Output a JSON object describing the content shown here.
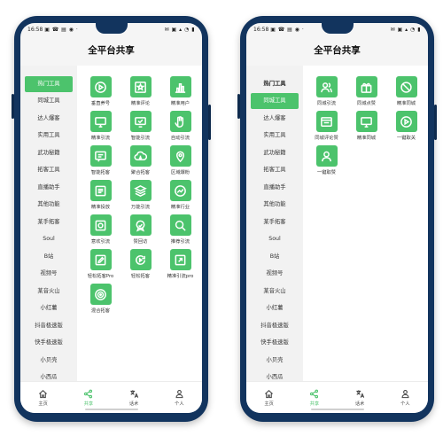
{
  "colors": {
    "accent": "#4cc36c",
    "phone_frame": "#12345e"
  },
  "phones": [
    {
      "status": {
        "time": "16:58",
        "left_icons": "▣ ☎ ▤ ◉ ·",
        "right_icons": "✉ ▣ ▴ ◔ ▮"
      },
      "title": "全平台共享",
      "sidebar": [
        {
          "label": "热门工具",
          "state": "active"
        },
        {
          "label": "同城工具",
          "state": ""
        },
        {
          "label": "达人爆客",
          "state": ""
        },
        {
          "label": "实用工具",
          "state": ""
        },
        {
          "label": "武功秘籍",
          "state": ""
        },
        {
          "label": "拓客工具",
          "state": ""
        },
        {
          "label": "直播助手",
          "state": ""
        },
        {
          "label": "其他功能",
          "state": ""
        },
        {
          "label": "某手拓客",
          "state": ""
        },
        {
          "label": "Soul",
          "state": ""
        },
        {
          "label": "B站",
          "state": ""
        },
        {
          "label": "视频号",
          "state": ""
        },
        {
          "label": "某音火山",
          "state": ""
        },
        {
          "label": "小红薯",
          "state": ""
        },
        {
          "label": "抖音极速版",
          "state": ""
        },
        {
          "label": "快手极速版",
          "state": ""
        },
        {
          "label": "小贝壳",
          "state": ""
        },
        {
          "label": "小西瓜",
          "state": ""
        }
      ],
      "tools": [
        {
          "label": "垂直养号",
          "icon": "play-icon"
        },
        {
          "label": "精准评论",
          "icon": "star-icon"
        },
        {
          "label": "精准用户",
          "icon": "bar-chart-icon"
        },
        {
          "label": "精准引流",
          "icon": "screen-icon"
        },
        {
          "label": "智能引流",
          "icon": "screen-check-icon"
        },
        {
          "label": "自动引流",
          "icon": "hand-icon"
        },
        {
          "label": "智能拓客",
          "icon": "message-icon"
        },
        {
          "label": "聚合拓客",
          "icon": "cloud-icon"
        },
        {
          "label": "区域爆粉",
          "icon": "map-pin-icon"
        },
        {
          "label": "精准投放",
          "icon": "frame-icon"
        },
        {
          "label": "万能引流",
          "icon": "layers-icon"
        },
        {
          "label": "精准行业",
          "icon": "trend-icon"
        },
        {
          "label": "意欢引流",
          "icon": "dial-icon"
        },
        {
          "label": "赞回访",
          "icon": "badge-icon"
        },
        {
          "label": "推荐引流",
          "icon": "search-icon"
        },
        {
          "label": "轻松拓客Pro",
          "icon": "pencil-icon"
        },
        {
          "label": "轻松拓客",
          "icon": "refresh-icon"
        },
        {
          "label": "精准引流pro",
          "icon": "share-box-icon"
        },
        {
          "label": "混合拓客",
          "icon": "target-icon"
        }
      ]
    },
    {
      "status": {
        "time": "16:58",
        "left_icons": "▣ ☎ ▤ ◉ ·",
        "right_icons": "✉ ▣ ▴ ◔ ▮"
      },
      "title": "全平台共享",
      "sidebar": [
        {
          "label": "热门工具",
          "state": "heading"
        },
        {
          "label": "同城工具",
          "state": "active"
        },
        {
          "label": "达人爆客",
          "state": ""
        },
        {
          "label": "实用工具",
          "state": ""
        },
        {
          "label": "武功秘籍",
          "state": ""
        },
        {
          "label": "拓客工具",
          "state": ""
        },
        {
          "label": "直播助手",
          "state": ""
        },
        {
          "label": "其他功能",
          "state": ""
        },
        {
          "label": "某手拓客",
          "state": ""
        },
        {
          "label": "Soul",
          "state": ""
        },
        {
          "label": "B站",
          "state": ""
        },
        {
          "label": "视频号",
          "state": ""
        },
        {
          "label": "某音火山",
          "state": ""
        },
        {
          "label": "小红薯",
          "state": ""
        },
        {
          "label": "抖音极速版",
          "state": ""
        },
        {
          "label": "快手极速版",
          "state": ""
        },
        {
          "label": "小贝壳",
          "state": ""
        },
        {
          "label": "小西瓜",
          "state": ""
        }
      ],
      "tools": [
        {
          "label": "同城引流",
          "icon": "users-icon"
        },
        {
          "label": "同城点赞",
          "icon": "gift-icon"
        },
        {
          "label": "精准同城",
          "icon": "ban-icon"
        },
        {
          "label": "同城评论赞",
          "icon": "window-icon"
        },
        {
          "label": "精准同城",
          "icon": "screen-icon"
        },
        {
          "label": "一键取关",
          "icon": "play-icon"
        },
        {
          "label": "一键取赞",
          "icon": "user-icon"
        }
      ]
    }
  ],
  "tabbar": [
    {
      "label": "主页",
      "icon": "home-icon",
      "active": false
    },
    {
      "label": "共享",
      "icon": "share-icon",
      "active": true
    },
    {
      "label": "话术",
      "icon": "translate-icon",
      "active": false
    },
    {
      "label": "个人",
      "icon": "person-icon",
      "active": false
    }
  ]
}
